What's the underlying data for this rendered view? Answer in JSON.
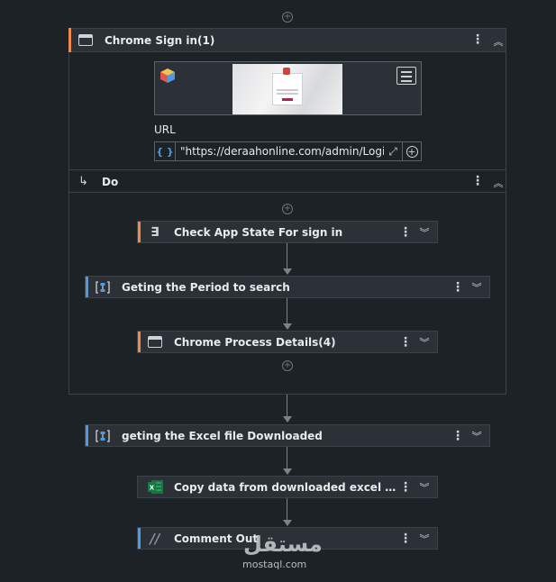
{
  "top_add": "+",
  "chrome_signin": {
    "title": "Chrome Sign in(1)",
    "url_label": "URL",
    "url_value": "\"https://deraahonline.com/admin/Login",
    "url_type_icon": "{ }",
    "accent": "#ef8a4a"
  },
  "do_section": {
    "label": "Do",
    "arrow_glyph": "↳"
  },
  "steps_inner": [
    {
      "name": "check-app-state",
      "label": "Check App State  For sign in",
      "icon": "check-app-state-icon",
      "accent": "#ef8a4a"
    },
    {
      "name": "period",
      "label": "Geting  the Period to search",
      "icon": "sequence-icon",
      "accent": "#4f9be3"
    },
    {
      "name": "chrome-process",
      "label": "Chrome Process Details(4)",
      "icon": "browser-window-icon",
      "accent": "#ef8a4a"
    }
  ],
  "steps_outer": [
    {
      "name": "excel-download",
      "label": "geting the Excel file Downloaded",
      "icon": "sequence-icon",
      "accent": "#4f9be3"
    },
    {
      "name": "copy-data",
      "label": "Copy data from downloaded excel & Ref...",
      "icon": "excel-icon",
      "accent": "#2b3137"
    },
    {
      "name": "comment-out",
      "label": "Comment Out",
      "icon": "comment-out-icon",
      "accent": "#4f9be3"
    }
  ],
  "watermark": {
    "arabic": "مستقل",
    "latin": "mostaql.com"
  }
}
